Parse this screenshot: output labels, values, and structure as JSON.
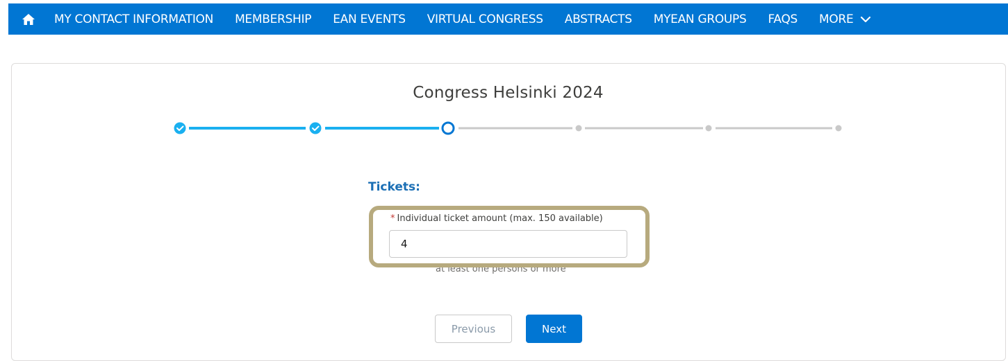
{
  "nav": {
    "items": [
      {
        "label": "MY CONTACT INFORMATION"
      },
      {
        "label": "MEMBERSHIP"
      },
      {
        "label": "EAN EVENTS"
      },
      {
        "label": "VIRTUAL CONGRESS"
      },
      {
        "label": "ABSTRACTS"
      },
      {
        "label": "MYEAN GROUPS"
      },
      {
        "label": "FAQS"
      },
      {
        "label": "MORE"
      }
    ]
  },
  "page": {
    "title": "Congress Helsinki 2024"
  },
  "progress": {
    "steps": [
      "complete",
      "complete",
      "current",
      "upcoming",
      "upcoming",
      "upcoming"
    ],
    "colors": {
      "complete": "#1ab0f0",
      "upcoming": "#c9c9c9"
    }
  },
  "tickets": {
    "heading": "Tickets:",
    "field_required_marker": "*",
    "field_label": "Individual ticket amount (max. 150 available)",
    "field_value": "4",
    "help_text": "at least one persons or more"
  },
  "actions": {
    "previous_label": "Previous",
    "next_label": "Next"
  },
  "colors": {
    "brand": "#0176d3",
    "highlight": "#b7aa7e"
  }
}
